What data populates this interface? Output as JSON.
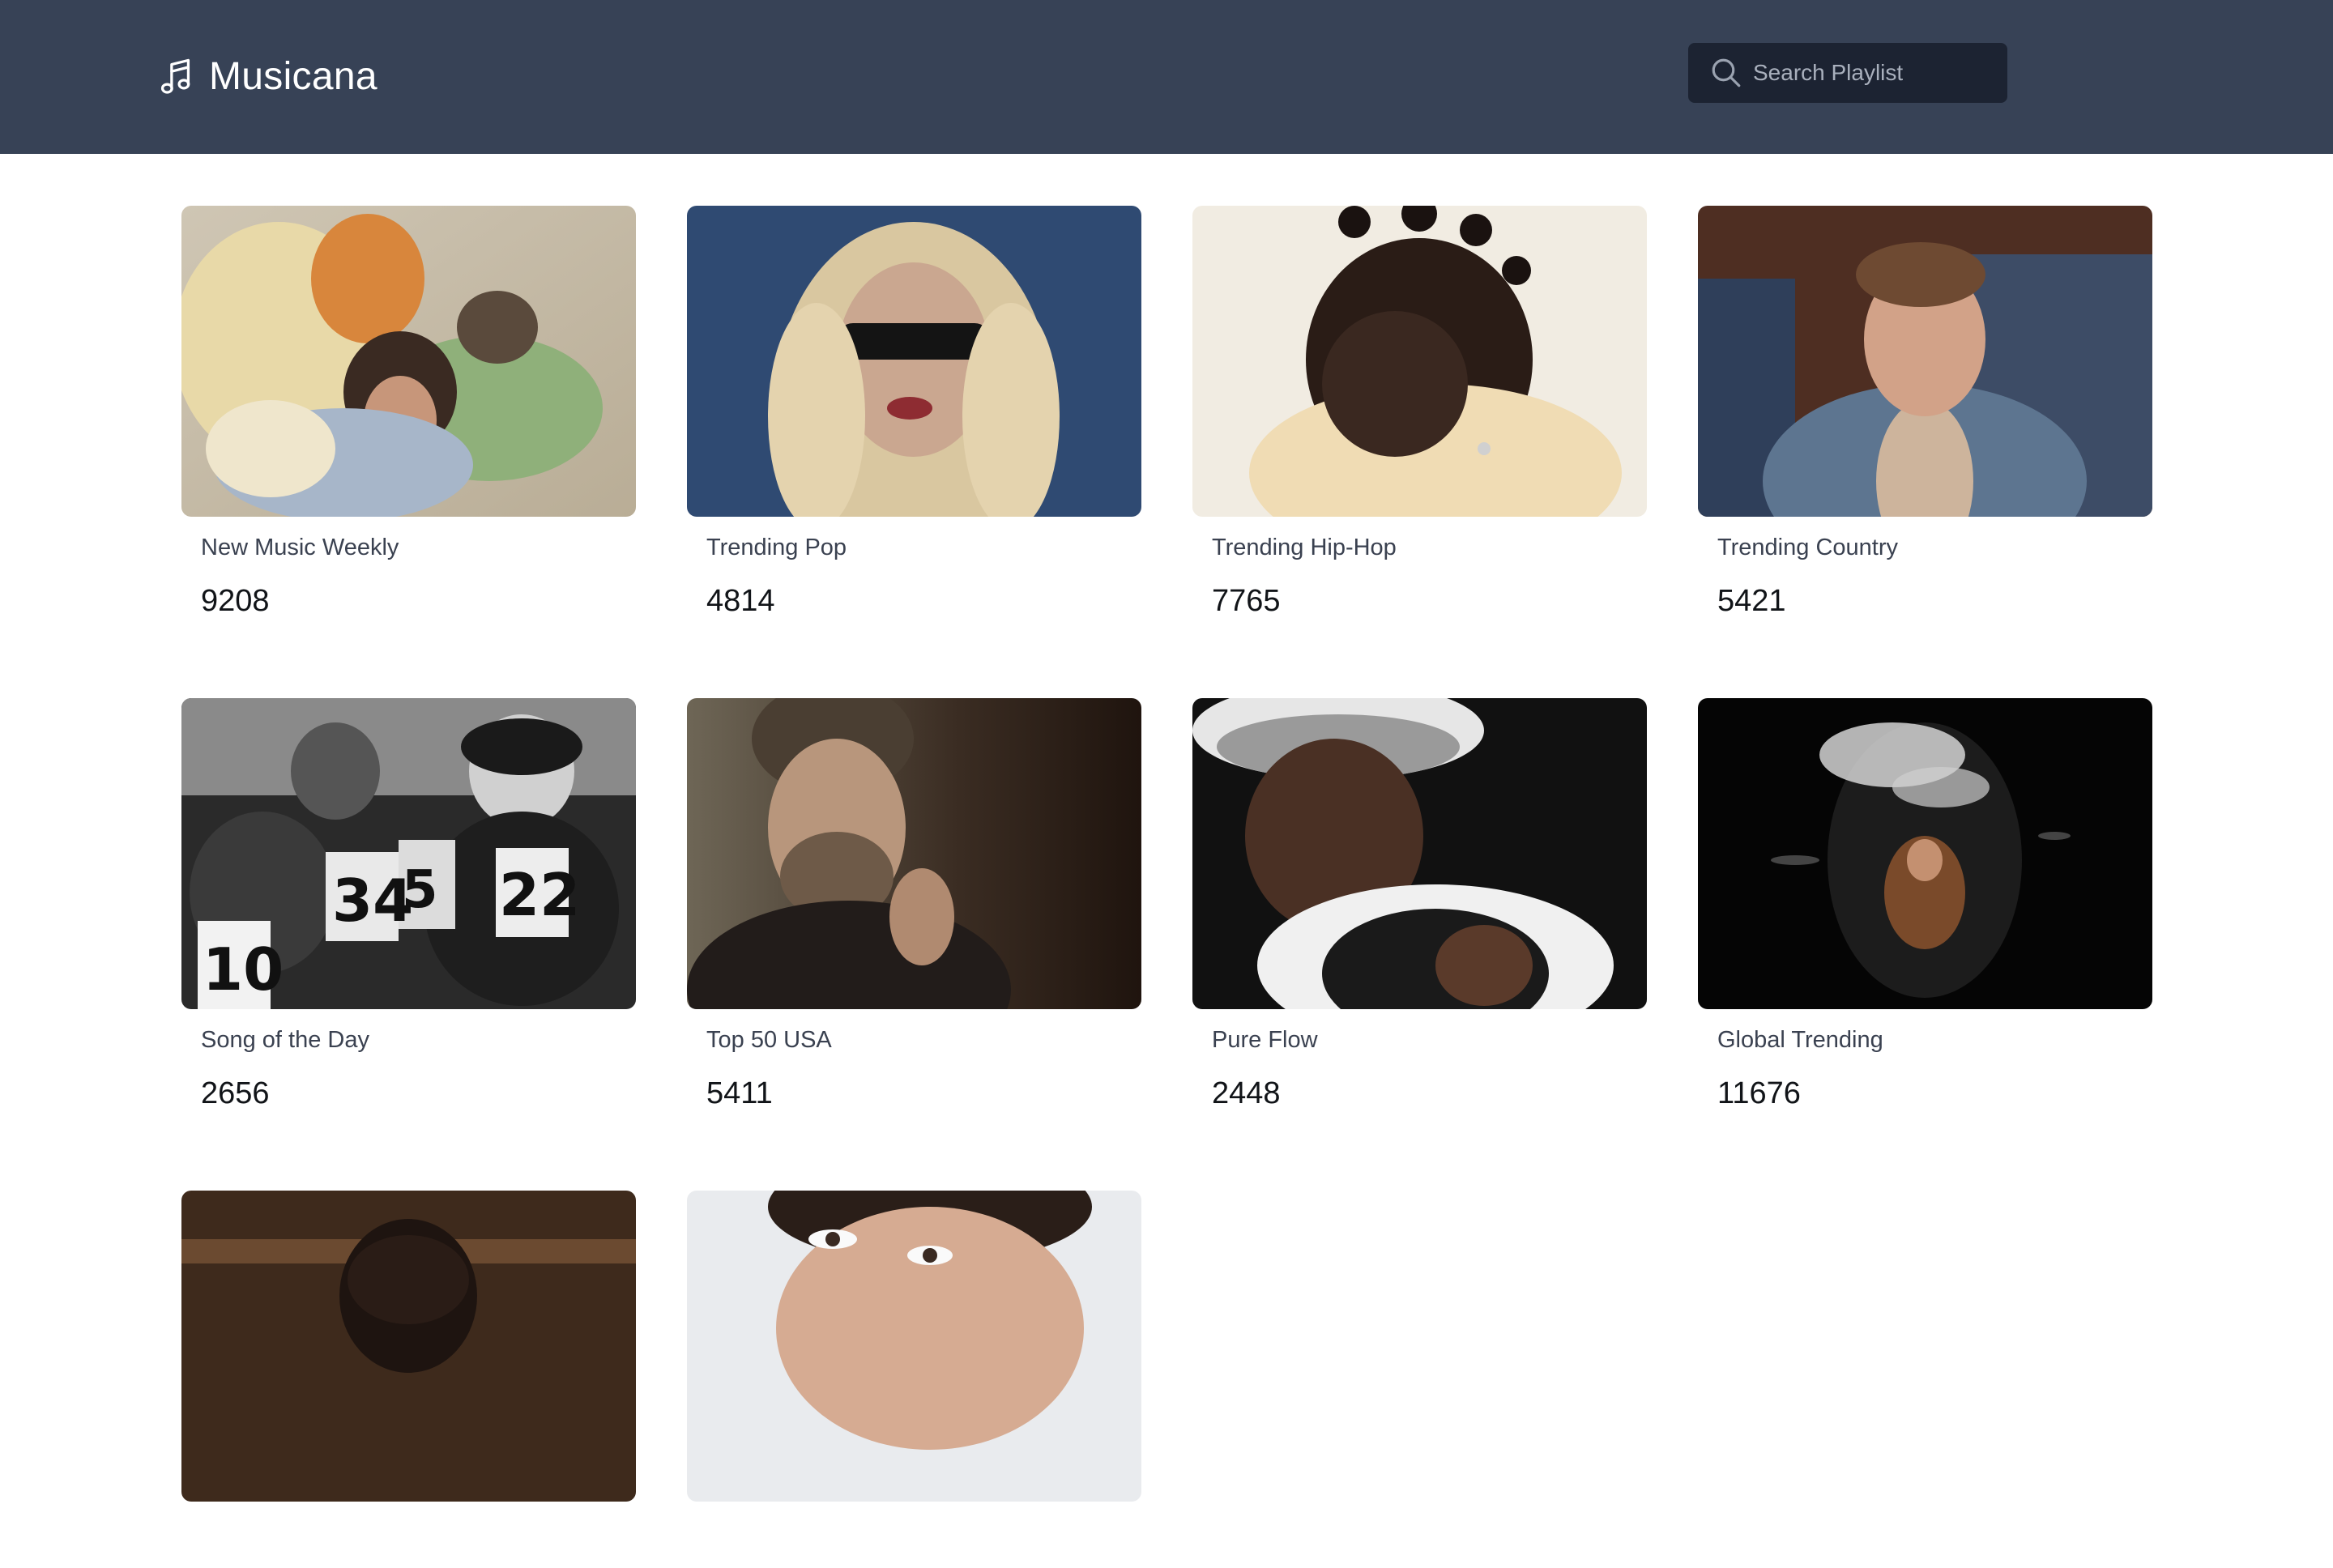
{
  "app": {
    "title": "Musicana",
    "logo_icon": "music-note-icon"
  },
  "search": {
    "placeholder": "Search Playlist",
    "icon": "search-icon"
  },
  "colors": {
    "header_bg": "#374256",
    "search_bg": "#1c2332"
  },
  "playlists": [
    {
      "title": "New Music Weekly",
      "count": "9208"
    },
    {
      "title": "Trending Pop",
      "count": "4814"
    },
    {
      "title": "Trending Hip-Hop",
      "count": "7765"
    },
    {
      "title": "Trending Country",
      "count": "5421"
    },
    {
      "title": "Song of the Day",
      "count": "2656"
    },
    {
      "title": "Top 50 USA",
      "count": "5411"
    },
    {
      "title": "Pure Flow",
      "count": "2448"
    },
    {
      "title": "Global Trending",
      "count": "11676"
    },
    {
      "title": "",
      "count": ""
    },
    {
      "title": "",
      "count": ""
    }
  ]
}
